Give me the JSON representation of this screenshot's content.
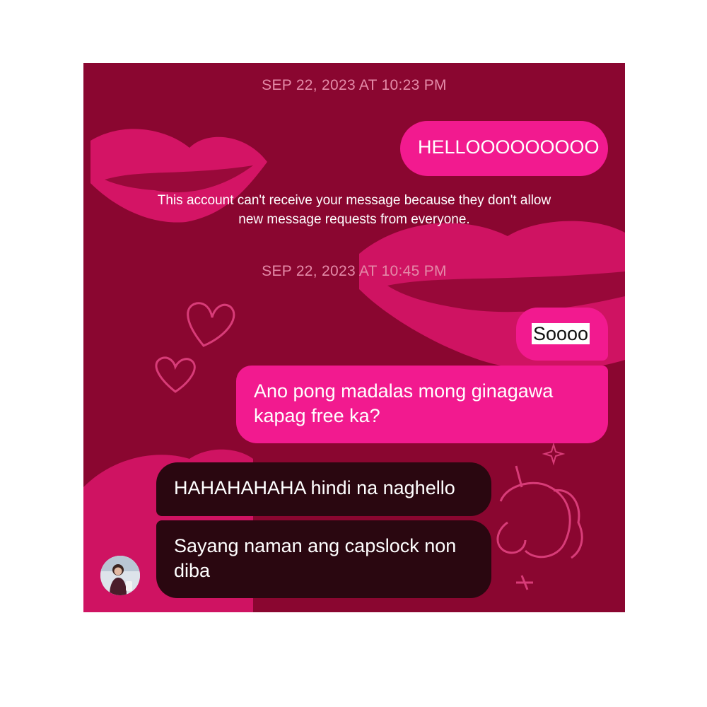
{
  "conversation": {
    "timestamps": [
      "SEP 22, 2023 AT 10:23 PM",
      "SEP 22, 2023 AT 10:45 PM"
    ],
    "notice": "This account can't receive your message because they don't allow new message requests from everyone.",
    "messages": [
      {
        "from": "me",
        "text": "HELLOOOOOOOOO"
      },
      {
        "from": "me",
        "text": "Soooo"
      },
      {
        "from": "me",
        "text": "Ano pong madalas mong ginagawa kapag free ka?"
      },
      {
        "from": "them",
        "text": "HAHAHAHAHA hindi na naghello"
      },
      {
        "from": "them",
        "text": "Sayang naman ang capslock non diba"
      }
    ],
    "avatar_icon": "user-avatar"
  },
  "theme": {
    "background": "#8a0630",
    "sent_bubble": "#f21a8f",
    "received_bubble": "#2a0710",
    "timestamp_color": "#e48aa8"
  }
}
